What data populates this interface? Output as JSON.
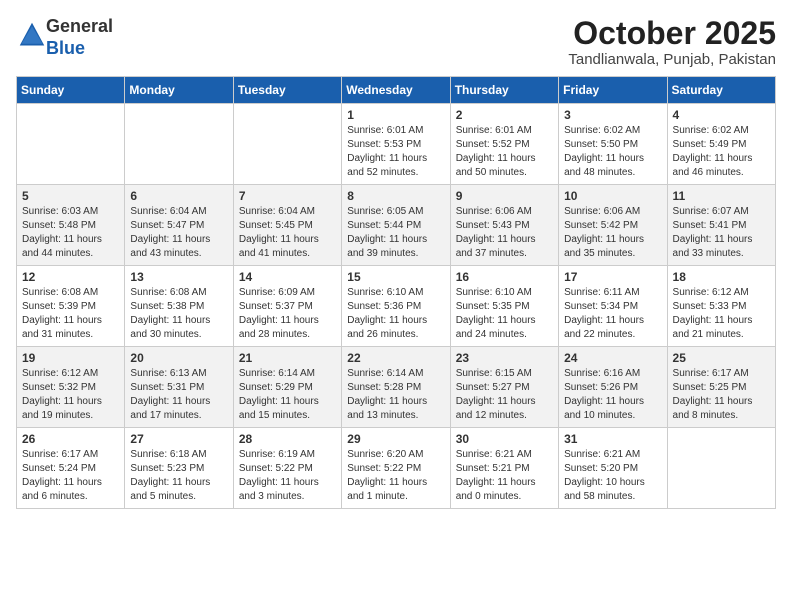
{
  "logo": {
    "general": "General",
    "blue": "Blue"
  },
  "header": {
    "month": "October 2025",
    "location": "Tandlianwala, Punjab, Pakistan"
  },
  "weekdays": [
    "Sunday",
    "Monday",
    "Tuesday",
    "Wednesday",
    "Thursday",
    "Friday",
    "Saturday"
  ],
  "weeks": [
    [
      {
        "day": "",
        "sunrise": "",
        "sunset": "",
        "daylight": ""
      },
      {
        "day": "",
        "sunrise": "",
        "sunset": "",
        "daylight": ""
      },
      {
        "day": "",
        "sunrise": "",
        "sunset": "",
        "daylight": ""
      },
      {
        "day": "1",
        "sunrise": "Sunrise: 6:01 AM",
        "sunset": "Sunset: 5:53 PM",
        "daylight": "Daylight: 11 hours and 52 minutes."
      },
      {
        "day": "2",
        "sunrise": "Sunrise: 6:01 AM",
        "sunset": "Sunset: 5:52 PM",
        "daylight": "Daylight: 11 hours and 50 minutes."
      },
      {
        "day": "3",
        "sunrise": "Sunrise: 6:02 AM",
        "sunset": "Sunset: 5:50 PM",
        "daylight": "Daylight: 11 hours and 48 minutes."
      },
      {
        "day": "4",
        "sunrise": "Sunrise: 6:02 AM",
        "sunset": "Sunset: 5:49 PM",
        "daylight": "Daylight: 11 hours and 46 minutes."
      }
    ],
    [
      {
        "day": "5",
        "sunrise": "Sunrise: 6:03 AM",
        "sunset": "Sunset: 5:48 PM",
        "daylight": "Daylight: 11 hours and 44 minutes."
      },
      {
        "day": "6",
        "sunrise": "Sunrise: 6:04 AM",
        "sunset": "Sunset: 5:47 PM",
        "daylight": "Daylight: 11 hours and 43 minutes."
      },
      {
        "day": "7",
        "sunrise": "Sunrise: 6:04 AM",
        "sunset": "Sunset: 5:45 PM",
        "daylight": "Daylight: 11 hours and 41 minutes."
      },
      {
        "day": "8",
        "sunrise": "Sunrise: 6:05 AM",
        "sunset": "Sunset: 5:44 PM",
        "daylight": "Daylight: 11 hours and 39 minutes."
      },
      {
        "day": "9",
        "sunrise": "Sunrise: 6:06 AM",
        "sunset": "Sunset: 5:43 PM",
        "daylight": "Daylight: 11 hours and 37 minutes."
      },
      {
        "day": "10",
        "sunrise": "Sunrise: 6:06 AM",
        "sunset": "Sunset: 5:42 PM",
        "daylight": "Daylight: 11 hours and 35 minutes."
      },
      {
        "day": "11",
        "sunrise": "Sunrise: 6:07 AM",
        "sunset": "Sunset: 5:41 PM",
        "daylight": "Daylight: 11 hours and 33 minutes."
      }
    ],
    [
      {
        "day": "12",
        "sunrise": "Sunrise: 6:08 AM",
        "sunset": "Sunset: 5:39 PM",
        "daylight": "Daylight: 11 hours and 31 minutes."
      },
      {
        "day": "13",
        "sunrise": "Sunrise: 6:08 AM",
        "sunset": "Sunset: 5:38 PM",
        "daylight": "Daylight: 11 hours and 30 minutes."
      },
      {
        "day": "14",
        "sunrise": "Sunrise: 6:09 AM",
        "sunset": "Sunset: 5:37 PM",
        "daylight": "Daylight: 11 hours and 28 minutes."
      },
      {
        "day": "15",
        "sunrise": "Sunrise: 6:10 AM",
        "sunset": "Sunset: 5:36 PM",
        "daylight": "Daylight: 11 hours and 26 minutes."
      },
      {
        "day": "16",
        "sunrise": "Sunrise: 6:10 AM",
        "sunset": "Sunset: 5:35 PM",
        "daylight": "Daylight: 11 hours and 24 minutes."
      },
      {
        "day": "17",
        "sunrise": "Sunrise: 6:11 AM",
        "sunset": "Sunset: 5:34 PM",
        "daylight": "Daylight: 11 hours and 22 minutes."
      },
      {
        "day": "18",
        "sunrise": "Sunrise: 6:12 AM",
        "sunset": "Sunset: 5:33 PM",
        "daylight": "Daylight: 11 hours and 21 minutes."
      }
    ],
    [
      {
        "day": "19",
        "sunrise": "Sunrise: 6:12 AM",
        "sunset": "Sunset: 5:32 PM",
        "daylight": "Daylight: 11 hours and 19 minutes."
      },
      {
        "day": "20",
        "sunrise": "Sunrise: 6:13 AM",
        "sunset": "Sunset: 5:31 PM",
        "daylight": "Daylight: 11 hours and 17 minutes."
      },
      {
        "day": "21",
        "sunrise": "Sunrise: 6:14 AM",
        "sunset": "Sunset: 5:29 PM",
        "daylight": "Daylight: 11 hours and 15 minutes."
      },
      {
        "day": "22",
        "sunrise": "Sunrise: 6:14 AM",
        "sunset": "Sunset: 5:28 PM",
        "daylight": "Daylight: 11 hours and 13 minutes."
      },
      {
        "day": "23",
        "sunrise": "Sunrise: 6:15 AM",
        "sunset": "Sunset: 5:27 PM",
        "daylight": "Daylight: 11 hours and 12 minutes."
      },
      {
        "day": "24",
        "sunrise": "Sunrise: 6:16 AM",
        "sunset": "Sunset: 5:26 PM",
        "daylight": "Daylight: 11 hours and 10 minutes."
      },
      {
        "day": "25",
        "sunrise": "Sunrise: 6:17 AM",
        "sunset": "Sunset: 5:25 PM",
        "daylight": "Daylight: 11 hours and 8 minutes."
      }
    ],
    [
      {
        "day": "26",
        "sunrise": "Sunrise: 6:17 AM",
        "sunset": "Sunset: 5:24 PM",
        "daylight": "Daylight: 11 hours and 6 minutes."
      },
      {
        "day": "27",
        "sunrise": "Sunrise: 6:18 AM",
        "sunset": "Sunset: 5:23 PM",
        "daylight": "Daylight: 11 hours and 5 minutes."
      },
      {
        "day": "28",
        "sunrise": "Sunrise: 6:19 AM",
        "sunset": "Sunset: 5:22 PM",
        "daylight": "Daylight: 11 hours and 3 minutes."
      },
      {
        "day": "29",
        "sunrise": "Sunrise: 6:20 AM",
        "sunset": "Sunset: 5:22 PM",
        "daylight": "Daylight: 11 hours and 1 minute."
      },
      {
        "day": "30",
        "sunrise": "Sunrise: 6:21 AM",
        "sunset": "Sunset: 5:21 PM",
        "daylight": "Daylight: 11 hours and 0 minutes."
      },
      {
        "day": "31",
        "sunrise": "Sunrise: 6:21 AM",
        "sunset": "Sunset: 5:20 PM",
        "daylight": "Daylight: 10 hours and 58 minutes."
      },
      {
        "day": "",
        "sunrise": "",
        "sunset": "",
        "daylight": ""
      }
    ]
  ]
}
